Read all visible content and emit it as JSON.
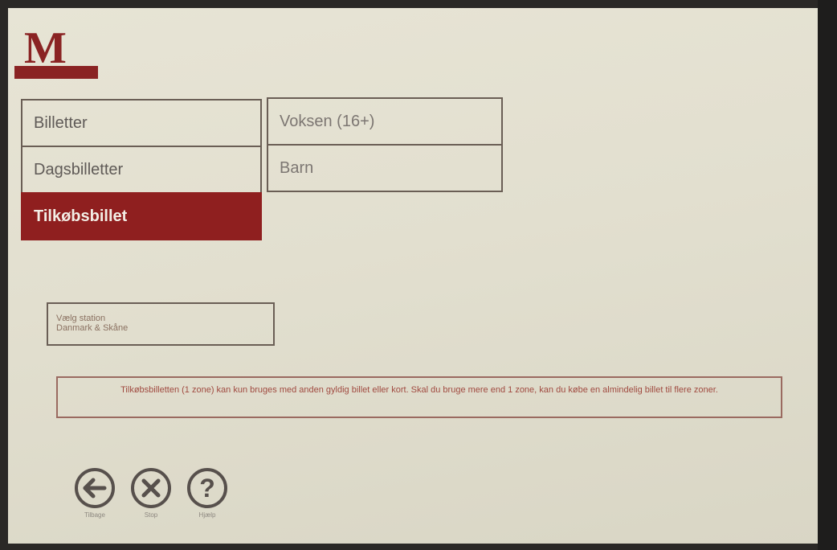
{
  "logo": {
    "letter": "M"
  },
  "menu": {
    "items": [
      {
        "label": "Billetter"
      },
      {
        "label": "Dagsbilletter"
      },
      {
        "label": "Tilkøbsbillet"
      }
    ]
  },
  "submenu": {
    "items": [
      {
        "label": "Voksen (16+)"
      },
      {
        "label": "Barn"
      }
    ]
  },
  "station": {
    "line1": "Vælg station",
    "line2": "Danmark & Skåne"
  },
  "info": {
    "text": "Tilkøbsbilletten (1 zone) kan kun bruges med anden gyldig billet eller kort. Skal du bruge mere end 1 zone, kan du købe en almindelig billet til flere zoner."
  },
  "nav": {
    "back_label": "Tilbage",
    "cancel_label": "Stop",
    "help_label": "Hjælp"
  },
  "colors": {
    "brand_red": "#8a2323",
    "active_bg": "#8f1f1f",
    "screen_bg": "#e4e1d2",
    "info_text": "#a04a40"
  }
}
